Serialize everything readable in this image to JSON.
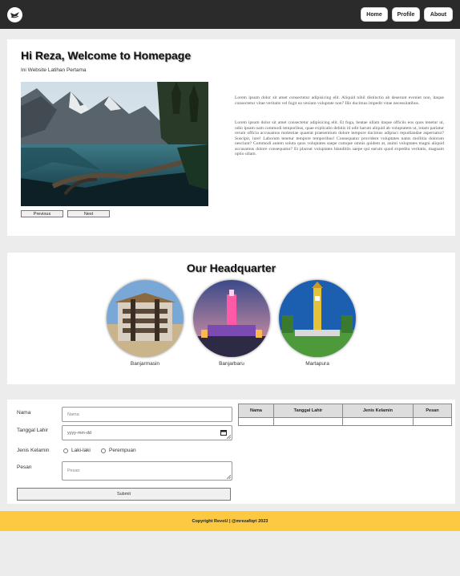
{
  "navbar": {
    "logo": "logo-icon",
    "items": [
      {
        "label": "Home"
      },
      {
        "label": "Profile"
      },
      {
        "label": "About"
      }
    ]
  },
  "hero": {
    "title": "Hi Reza, Welcome to Homepage",
    "subtitle": "Ini Website Latihan Pertama",
    "image": "mountain-lake-photo",
    "previous_label": "Previous",
    "next_label": "Next",
    "paragraph1": "Lorem ipsum dolor sit amet consectetur adipisicing elit. Aliquid nihil distinctio ab deserunt eveniet non, itaque consectetur vitae veritatis vel fugit ea veniam voluptate non? Illo ducimus impedit vitae necessitatibus.",
    "paragraph2": "Lorem ipsum dolor sit amet consectetur adipisicing elit. Et fuga, beatae ullam itaque officiis eos quos tenetur ut, odio ipsam nam commodi temporibus, quae explicabo debitis id odit harum aliquid ab voluptatem ut, totam pariatur rerum officia accusamus molestiae quaerat praesentium dolore tempore ducimus adipisci repudiandae aspernatur? Suscipit, iure! Laborum tenetur tempore temporibus! Consequatur provident voluptates natus mollitia dolorum nesciunt? Commodi autem soluta quos voluptates saepe cumque omnis quidem at, animi voluptates magni aliquid accusamus dolore consequatur? Et placeat voluptates blanditiis saepe qui earum quod expedita veritatis, magnam optio ullam."
  },
  "headquarter": {
    "title": "Our Headquarter",
    "cities": [
      {
        "label": "Banjarmasin"
      },
      {
        "label": "Banjarbaru"
      },
      {
        "label": "Martapura"
      }
    ]
  },
  "form": {
    "nama_label": "Nama",
    "nama_placeholder": "Nama",
    "tanggal_label": "Tanggal Lahir",
    "tanggal_placeholder": "yyyy-mm-dd",
    "jenis_label": "Jenis Kelamin",
    "option_male": "Laki-laki",
    "option_female": "Perempuan",
    "pesan_label": "Pesan",
    "pesan_placeholder": "Pesan",
    "submit_label": "Submit"
  },
  "table": {
    "headers": [
      "Nama",
      "Tanggal Lahir",
      "Jenis Kelamin",
      "Pesan"
    ]
  },
  "footer": {
    "text": "Copyright RevoU | @mrezafiqri 2023"
  }
}
